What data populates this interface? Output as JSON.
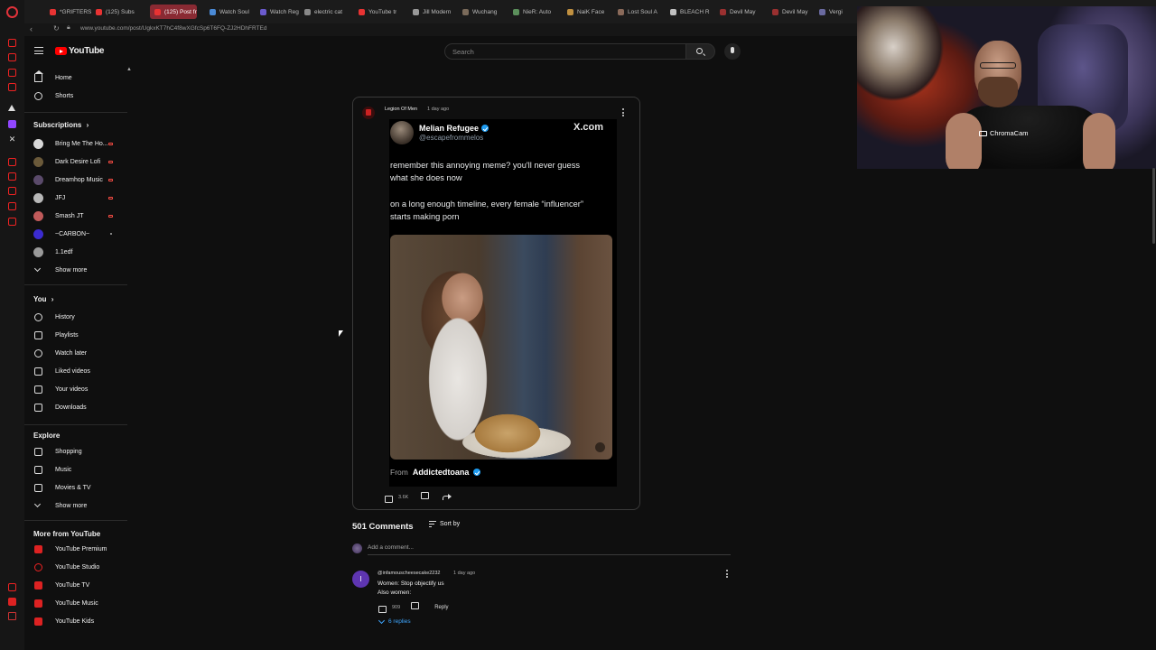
{
  "browser": {
    "tabs": [
      {
        "label": "*GRIFTERS",
        "icon_color": "#e83333"
      },
      {
        "label": "(125) Subs",
        "icon_color": "#e83333"
      },
      {
        "label": "(125) Post from Leg",
        "icon_color": "#e83333",
        "active": true
      },
      {
        "label": "Watch Soul",
        "icon_color": "#4a8ad6"
      },
      {
        "label": "Watch Reg",
        "icon_color": "#6a5acd"
      },
      {
        "label": "electric cat",
        "icon_color": "#888888"
      },
      {
        "label": "YouTube tr",
        "icon_color": "#e83333"
      },
      {
        "label": "Jill Modern",
        "icon_color": "#999999"
      },
      {
        "label": "Wuchang",
        "icon_color": "#7a6a5a"
      },
      {
        "label": "NieR: Auto",
        "icon_color": "#5b8f5b"
      },
      {
        "label": "NaiK Face",
        "icon_color": "#c09040"
      },
      {
        "label": "Lost Soul A",
        "icon_color": "#8a6a5a"
      },
      {
        "label": "BLEACH R",
        "icon_color": "#c0c0c0"
      },
      {
        "label": "Devil May",
        "icon_color": "#9a3030"
      },
      {
        "label": "Devil May",
        "icon_color": "#9a3030"
      },
      {
        "label": "Vergi",
        "icon_color": "#6a6aa0"
      }
    ],
    "url": "www.youtube.com/post/UgkxKT7hC4f8wXGfcSp6T6FQ-ZJ2HDhFRTEd"
  },
  "youtube": {
    "logo_text": "YouTube",
    "search_placeholder": "Search"
  },
  "sidebar": {
    "main": [
      {
        "label": "Home",
        "icon": "home-icon"
      },
      {
        "label": "Shorts",
        "icon": "shorts-icon"
      }
    ],
    "subscriptions_title": "Subscriptions",
    "subscriptions": [
      {
        "label": "Bring Me The Ho...",
        "avatar_color": "#d8d8d8",
        "live": true
      },
      {
        "label": "Dark Desire Lofi",
        "avatar_color": "#6b5a3a",
        "live": true
      },
      {
        "label": "Dreamhop Music",
        "avatar_color": "#5a4a6a",
        "live": true
      },
      {
        "label": "JFJ",
        "avatar_color": "#b8b8b8",
        "live": true
      },
      {
        "label": "Smash JT",
        "avatar_color": "#c05a5a",
        "live": true
      },
      {
        "label": "~CARBON~",
        "avatar_color": "#3b2bd0",
        "live": false
      },
      {
        "label": "1.1edf",
        "avatar_color": "#9a9a9a",
        "live": false
      }
    ],
    "subs_show_more": "Show more",
    "you_title": "You",
    "you": [
      {
        "label": "History",
        "icon": "history-icon"
      },
      {
        "label": "Playlists",
        "icon": "playlists-icon"
      },
      {
        "label": "Watch later",
        "icon": "watch-later-icon"
      },
      {
        "label": "Liked videos",
        "icon": "liked-icon"
      },
      {
        "label": "Your videos",
        "icon": "your-videos-icon"
      },
      {
        "label": "Downloads",
        "icon": "downloads-icon"
      }
    ],
    "explore_title": "Explore",
    "explore": [
      {
        "label": "Shopping",
        "icon": "shopping-icon"
      },
      {
        "label": "Music",
        "icon": "music-icon"
      },
      {
        "label": "Movies & TV",
        "icon": "movies-icon"
      }
    ],
    "explore_show_more": "Show more",
    "more_title": "More from YouTube",
    "more": [
      {
        "label": "YouTube Premium",
        "icon": "youtube-premium-icon"
      },
      {
        "label": "YouTube Studio",
        "icon": "youtube-studio-icon"
      },
      {
        "label": "YouTube TV",
        "icon": "youtube-tv-icon"
      },
      {
        "label": "YouTube Music",
        "icon": "youtube-music-icon"
      },
      {
        "label": "YouTube Kids",
        "icon": "youtube-kids-icon"
      }
    ]
  },
  "post": {
    "channel": "Legion Of Men",
    "time": "1 day ago",
    "tweet": {
      "name": "Melian Refugee",
      "handle": "@escapefrommelos",
      "source": "X.com",
      "line1": "remember this annoying meme? you'll never guess",
      "line2": "what she does now",
      "line3": "on a long enough timeline, every female “influencer”",
      "line4": "starts making porn",
      "from_label": "From",
      "from_account": "Addictedtoana"
    },
    "likes": "3.6K"
  },
  "comments": {
    "count_label": "501 Comments",
    "sort_label": "Sort by",
    "add_placeholder": "Add a comment...",
    "items": [
      {
        "avatar_letter": "I",
        "author": "@infamouscheesecake2232",
        "time": "1 day ago",
        "line1": "Women: Stop objectify us",
        "line2": "Also women:",
        "likes": "909",
        "reply_label": "Reply",
        "replies_label": "6 replies"
      }
    ]
  },
  "webcam": {
    "label": "ChromaCam"
  }
}
